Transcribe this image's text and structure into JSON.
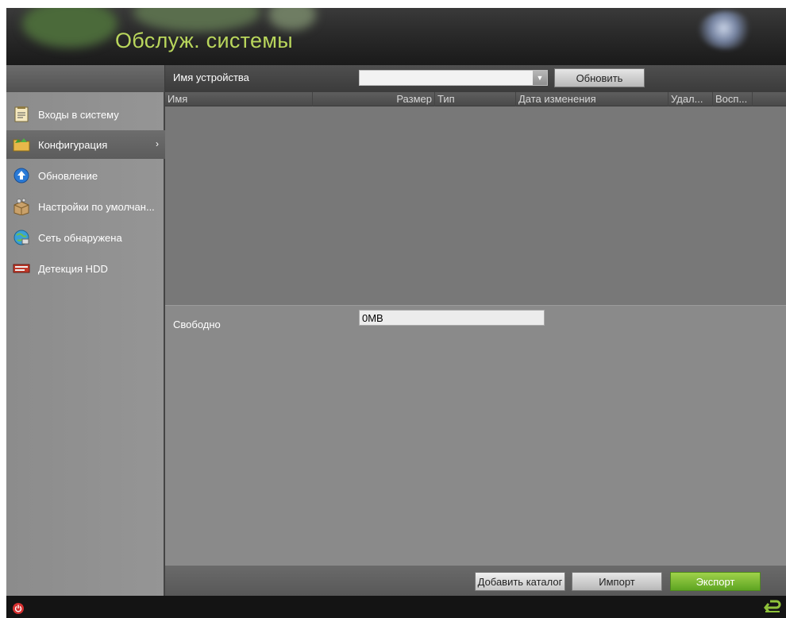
{
  "header": {
    "title": "Обслуж. системы"
  },
  "sidebar": {
    "items": [
      {
        "label": "Входы в систему",
        "icon": "log-document-icon"
      },
      {
        "label": "Конфигурация",
        "icon": "folder-icon",
        "active": true,
        "chevron": "›"
      },
      {
        "label": "Обновление",
        "icon": "upgrade-arrow-icon"
      },
      {
        "label": "Настройки по умолчан...",
        "icon": "default-settings-box-icon"
      },
      {
        "label": "Сеть обнаружена",
        "icon": "network-globe-icon"
      },
      {
        "label": "Детекция HDD",
        "icon": "hdd-icon"
      }
    ]
  },
  "toolbar": {
    "device_label": "Имя устройства",
    "device_value": "",
    "refresh_label": "Обновить"
  },
  "table": {
    "columns": [
      "Имя",
      "Размер",
      "Тип",
      "Дата изменения",
      "Удал...",
      "Восп..."
    ],
    "rows": []
  },
  "storage": {
    "free_label": "Свободно",
    "free_value": "0MB"
  },
  "actions": {
    "add_dir_label": "Добавить каталог",
    "import_label": "Импорт",
    "export_label": "Экспорт"
  },
  "colors": {
    "title_green": "#b9d65c",
    "export_green": "#6db12c",
    "power_red": "#d63030"
  }
}
